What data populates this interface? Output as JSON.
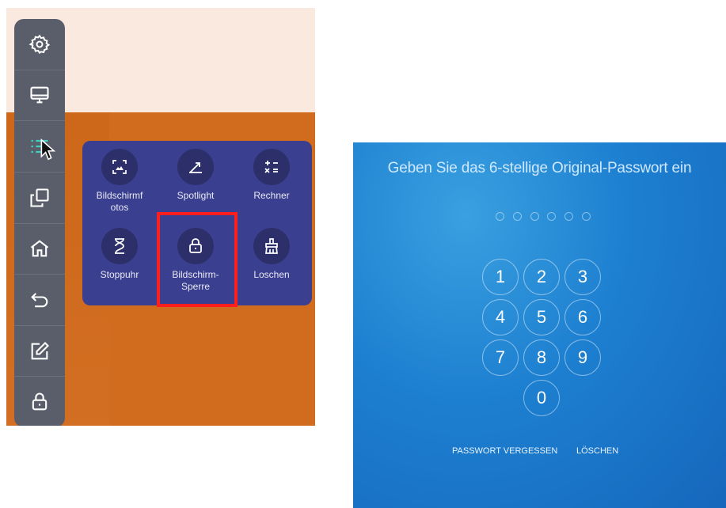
{
  "sidebar": {
    "items": [
      {
        "icon": "gear-icon"
      },
      {
        "icon": "monitor-icon"
      },
      {
        "icon": "list-icon"
      },
      {
        "icon": "windows-icon"
      },
      {
        "icon": "home-icon"
      },
      {
        "icon": "back-icon"
      },
      {
        "icon": "edit-icon"
      },
      {
        "icon": "lock-icon"
      }
    ]
  },
  "toolbox": {
    "items": [
      {
        "label_line1": "Bildschirmf",
        "label_line2": "otos",
        "icon": "screenshot-icon"
      },
      {
        "label_line1": "Spotlight",
        "label_line2": "",
        "icon": "spotlight-icon"
      },
      {
        "label_line1": "Rechner",
        "label_line2": "",
        "icon": "calculator-icon"
      },
      {
        "label_line1": "Stoppuhr",
        "label_line2": "",
        "icon": "hourglass-icon"
      },
      {
        "label_line1": "Bildschirm-",
        "label_line2": "Sperre",
        "icon": "lock-icon"
      },
      {
        "label_line1": "Loschen",
        "label_line2": "",
        "icon": "broom-icon"
      }
    ],
    "highlighted_item": "Bildschirm-Sperre"
  },
  "lockscreen": {
    "title": "Geben Sie das 6-stellige Original-Passwort ein",
    "keys": [
      "1",
      "2",
      "3",
      "4",
      "5",
      "6",
      "7",
      "8",
      "9",
      "0"
    ],
    "forgot_label": "PASSWORT VERGESSEN",
    "delete_label": "LÖSCHEN"
  },
  "colors": {
    "orange": "#d16c1e",
    "popup": "#3b3f8f",
    "highlight": "#ff1e1e",
    "lock_blue": "#1d7fd0"
  }
}
